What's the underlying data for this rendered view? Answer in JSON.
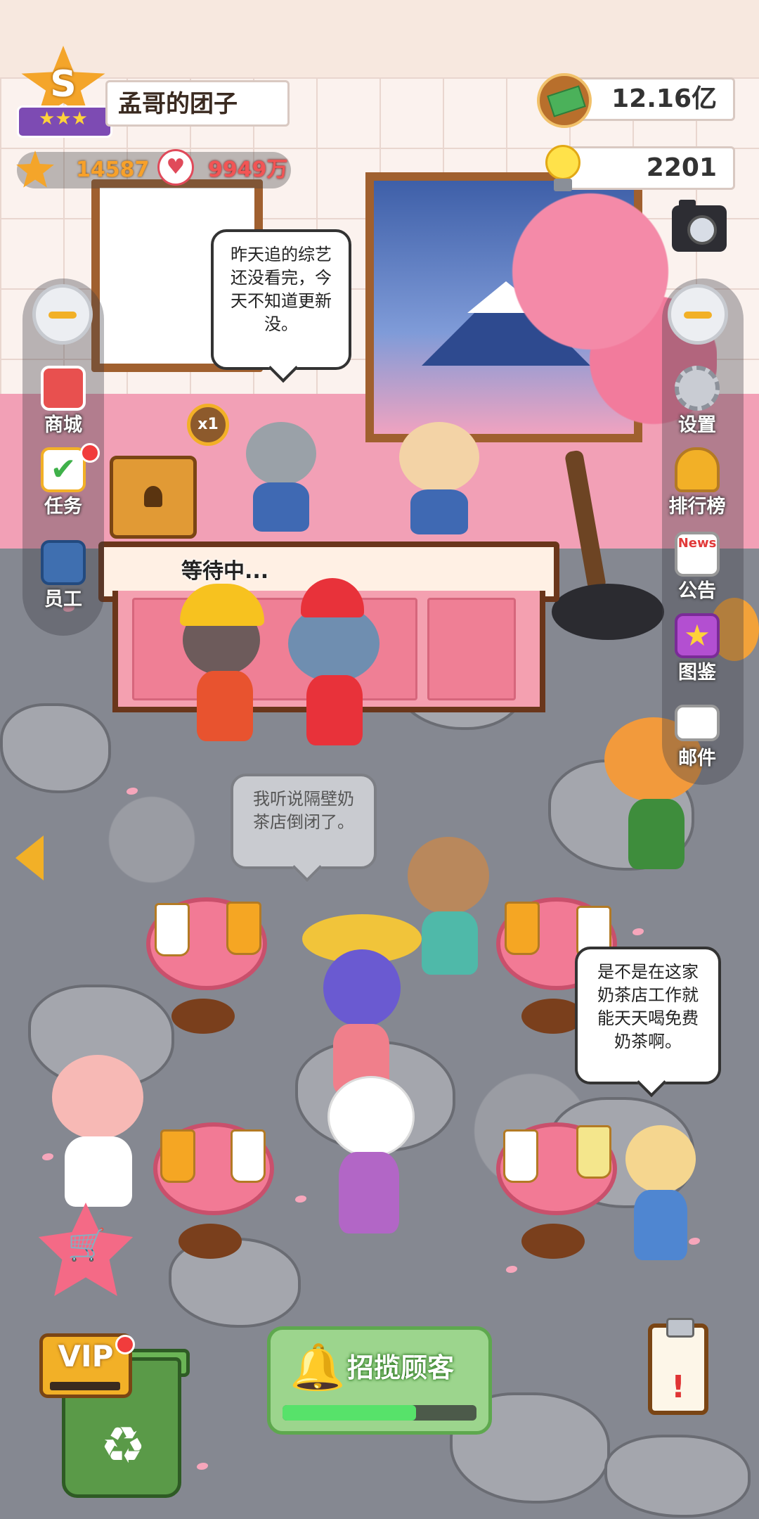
{
  "hud": {
    "rank_letter": "S",
    "rank_stars": "★★★",
    "shop_name": "孟哥的团子",
    "star_count": "14587",
    "fans_count": "9949万",
    "money": "12.16亿",
    "ideas": "2201"
  },
  "left_menu": [
    {
      "label": "商城",
      "icon": "shop-icon",
      "color": "#e8504f"
    },
    {
      "label": "任务",
      "icon": "task-calendar-icon",
      "color": "#f2b027"
    },
    {
      "label": "员工",
      "icon": "staff-icon",
      "color": "#3f6fb0"
    }
  ],
  "right_menu": [
    {
      "label": "设置",
      "icon": "gear-icon",
      "color": "#c9ccd3"
    },
    {
      "label": "排行榜",
      "icon": "trophy-icon",
      "color": "#f2b027"
    },
    {
      "label": "公告",
      "icon": "news-icon",
      "color": "#ffffff",
      "badge_text": "News"
    },
    {
      "label": "图鉴",
      "icon": "collection-star-icon",
      "color": "#b34fd1"
    },
    {
      "label": "邮件",
      "icon": "mail-icon",
      "color": "#ffffff"
    }
  ],
  "scene": {
    "x1_badge": "x1",
    "waiting": "等待中...",
    "bubbles": {
      "staff": "昨天追的综艺还没看完，今天不知道更新没。",
      "customer_gossip": "我听说隔壁奶茶店倒闭了。",
      "customer_wish": "是不是在这家奶茶店工作就能天天喝免费奶茶啊。"
    }
  },
  "bottom": {
    "vip": "VIP",
    "recruit_label": "招揽顾客",
    "recruit_progress": 0.69
  },
  "colors": {
    "accent_gold": "#f2b027",
    "recruit_green": "#9cd58d",
    "sakura_pink": "#f27a95"
  }
}
